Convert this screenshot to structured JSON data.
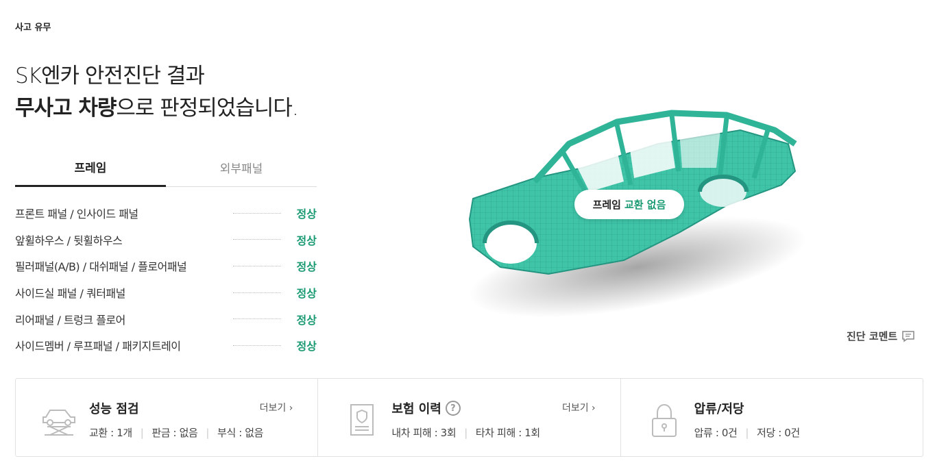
{
  "section_label": "사고 유무",
  "headline": {
    "line1": "SK엔카 안전진단 결과",
    "line2_bold": "무사고 차량",
    "line2_rest": "으로 판정되었습니다."
  },
  "tabs": [
    {
      "label": "프레임",
      "active": true
    },
    {
      "label": "외부패널",
      "active": false
    }
  ],
  "checks": [
    {
      "name": "프론트 패널 / 인사이드 패널",
      "status": "정상"
    },
    {
      "name": "앞휠하우스 / 뒷휠하우스",
      "status": "정상"
    },
    {
      "name": "필러패널(A/B) / 대쉬패널 / 플로어패널",
      "status": "정상"
    },
    {
      "name": "사이드실 패널 / 쿼터패널",
      "status": "정상"
    },
    {
      "name": "리어패널 / 트렁크 플로어",
      "status": "정상"
    },
    {
      "name": "사이드멤버 / 루프패널 / 패키지트레이",
      "status": "정상"
    }
  ],
  "frame_badge": {
    "prefix": "프레임",
    "highlight": "교환 없음"
  },
  "comment_link": "진단 코멘트",
  "summary": {
    "performance": {
      "title": "성능 점검",
      "more": "더보기 ›",
      "stats": [
        "교환 : 1개",
        "판금 : 없음",
        "부식 : 없음"
      ],
      "icon": "car-lift-icon"
    },
    "insurance": {
      "title": "보험 이력",
      "help": "?",
      "more": "더보기 ›",
      "stats": [
        "내차 피해 : 3회",
        "타차 피해 : 1회"
      ],
      "icon": "insurance-document-icon"
    },
    "seizure": {
      "title": "압류/저당",
      "stats": [
        "압류 : 0건",
        "저당 : 0건"
      ],
      "icon": "lock-icon"
    }
  },
  "colors": {
    "accent_green": "#1a9a72",
    "frame_teal": "#3fc4a8"
  }
}
